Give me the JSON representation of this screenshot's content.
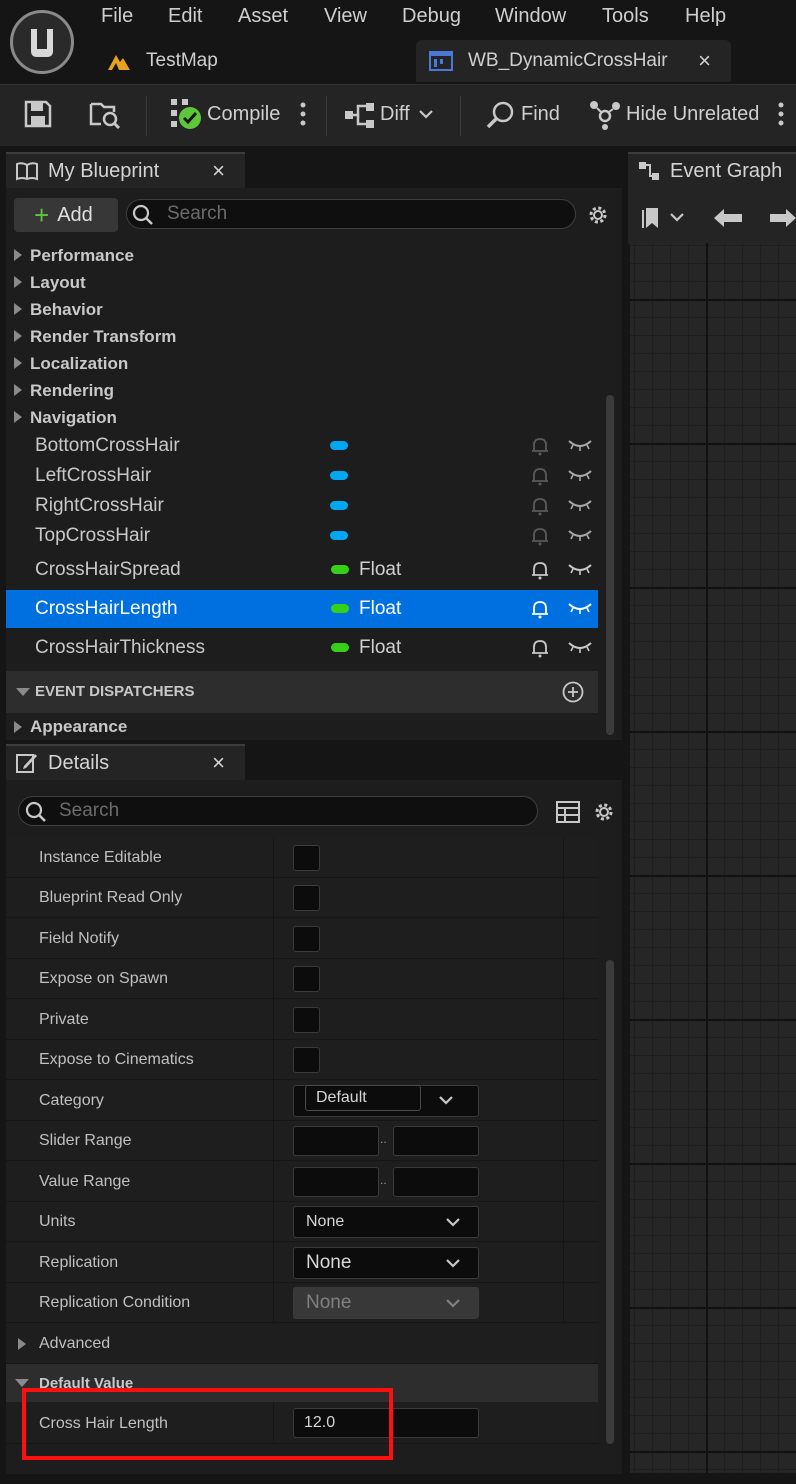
{
  "menu": [
    "File",
    "Edit",
    "Asset",
    "View",
    "Debug",
    "Window",
    "Tools",
    "Help"
  ],
  "tabs": {
    "map": "TestMap",
    "active": "WB_DynamicCrossHair",
    "close": "×"
  },
  "toolbar": {
    "compile": "Compile",
    "diff": "Diff",
    "find": "Find",
    "hide_unrelated": "Hide Unrelated"
  },
  "my_blueprint": {
    "title": "My Blueprint",
    "close": "×",
    "add": "Add",
    "search_placeholder": "Search",
    "categories": [
      "Performance",
      "Layout",
      "Behavior",
      "Render Transform",
      "Localization",
      "Rendering",
      "Navigation"
    ],
    "widget_vars": [
      "BottomCrossHair",
      "LeftCrossHair",
      "RightCrossHair",
      "TopCrossHair"
    ],
    "float_vars": [
      {
        "name": "CrossHairSpread",
        "type": "Float"
      },
      {
        "name": "CrossHairLength",
        "type": "Float"
      },
      {
        "name": "CrossHairThickness",
        "type": "Float"
      }
    ],
    "event_dispatchers": "EVENT DISPATCHERS",
    "appearance": "Appearance"
  },
  "event_graph": {
    "title": "Event Graph"
  },
  "details": {
    "title": "Details",
    "close": "×",
    "search_placeholder": "Search",
    "rows": {
      "instance_editable": "Instance Editable",
      "blueprint_read_only": "Blueprint Read Only",
      "field_notify": "Field Notify",
      "expose_on_spawn": "Expose on Spawn",
      "private": "Private",
      "expose_to_cinematics": "Expose to Cinematics",
      "category": "Category",
      "category_value": "Default",
      "slider_range": "Slider Range",
      "value_range": "Value Range",
      "units": "Units",
      "units_value": "None",
      "replication": "Replication",
      "replication_value": "None",
      "replication_condition": "Replication Condition",
      "replication_condition_value": "None",
      "range_separator": ".."
    },
    "advanced": "Advanced",
    "default_value": "Default Value",
    "default_field_label": "Cross Hair Length",
    "default_field_value": "12.0"
  },
  "colors": {
    "selected": "#0070e0",
    "widget_pill": "#00a8f4",
    "float_pill": "#36d018",
    "highlight": "#ff1010",
    "check": "#5ec63a"
  }
}
